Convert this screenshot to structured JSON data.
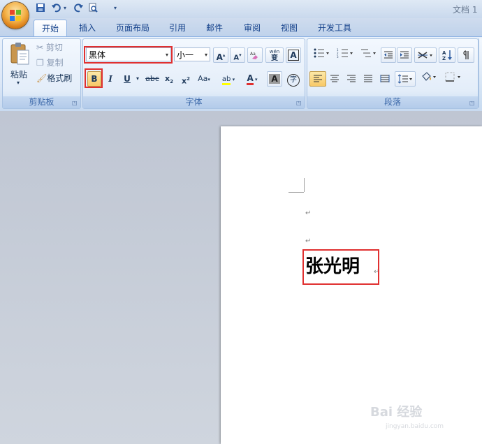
{
  "window": {
    "title": "文档 1"
  },
  "quick_access": {
    "save": "save-icon",
    "undo": "undo-icon",
    "redo": "redo-icon",
    "print_preview": "print-preview-icon",
    "customize": "▾"
  },
  "tabs": [
    {
      "label": "开始",
      "active": true
    },
    {
      "label": "插入"
    },
    {
      "label": "页面布局"
    },
    {
      "label": "引用"
    },
    {
      "label": "邮件"
    },
    {
      "label": "审阅"
    },
    {
      "label": "视图"
    },
    {
      "label": "开发工具"
    }
  ],
  "clipboard": {
    "group_label": "剪贴板",
    "paste_label": "粘贴",
    "cut_label": "剪切",
    "copy_label": "复制",
    "format_painter_label": "格式刷"
  },
  "font": {
    "group_label": "字体",
    "font_name": "黑体",
    "font_size": "小一",
    "grow": "A",
    "shrink": "A",
    "bold": "B",
    "italic": "I",
    "underline": "U",
    "strike": "abc",
    "subscript": "x",
    "superscript": "x",
    "sub_mark": "2",
    "sup_mark": "2",
    "change_case": "Aa",
    "highlight": "ab",
    "font_color": "A",
    "char_shading": "A",
    "enclose": "字",
    "phonetic": "wén",
    "phonetic_char": "变",
    "border_char": "A"
  },
  "paragraph": {
    "group_label": "段落"
  },
  "document": {
    "name_text": "张光明",
    "paragraph_mark": "↵"
  },
  "watermark": {
    "brand": "Bai 经验",
    "url": "jingyan.baidu.com"
  },
  "colors": {
    "highlight_red": "#e03030",
    "ribbon_blue": "#15428b"
  }
}
